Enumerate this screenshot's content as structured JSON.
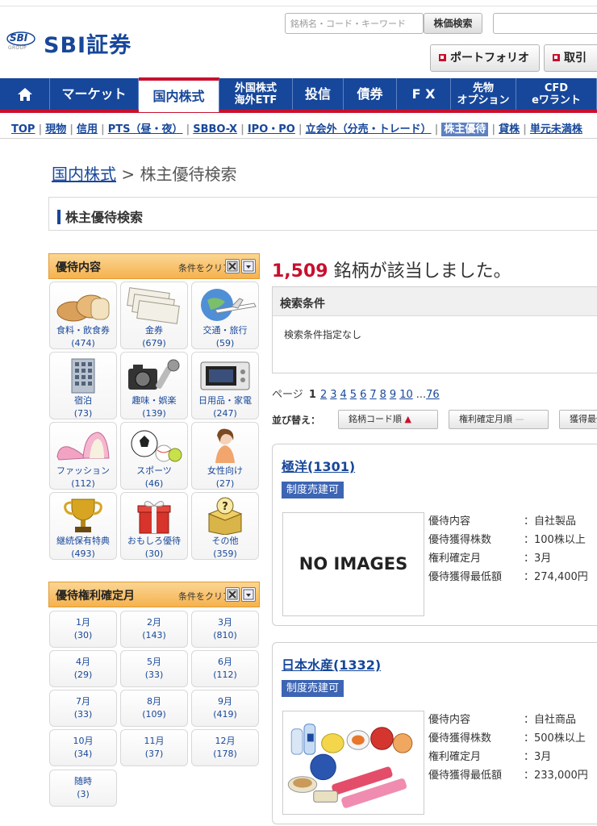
{
  "header": {
    "logo_mark": "SBI",
    "logo_sub": "GROUP",
    "logo_text": "SBI証券",
    "search_placeholder": "銘柄名・コード・キーワード",
    "search_button": "株価検索",
    "portfolio_button": "ポートフォリオ",
    "trade_button": "取引"
  },
  "nav": [
    {
      "label": "マーケット"
    },
    {
      "label": "国内株式",
      "active": true
    },
    {
      "label": "外国株式\n海外ETF"
    },
    {
      "label": "投信"
    },
    {
      "label": "債券"
    },
    {
      "label": "F X"
    },
    {
      "label": "先物\nオプション"
    },
    {
      "label": "CFD\neワラント"
    }
  ],
  "subnav": [
    "TOP",
    "現物",
    "信用",
    "PTS（昼・夜）",
    "SBBO-X",
    "IPO・PO",
    "立会外（分売・トレード）",
    "株主優待",
    "貸株",
    "単元未満株"
  ],
  "subnav_current": "株主優待",
  "breadcrumb": {
    "link": "国内株式",
    "separator": " > ",
    "current": "株主優待検索"
  },
  "page_title": "株主優待検索",
  "benefit_panel": {
    "title": "優待内容",
    "clear_label": "条件をクリア",
    "categories": [
      {
        "label": "食料・飲食券",
        "count": "(474)",
        "icon": "bread-icon"
      },
      {
        "label": "金券",
        "count": "(679)",
        "icon": "voucher-icon"
      },
      {
        "label": "交通・旅行",
        "count": "(59)",
        "icon": "airplane-icon"
      },
      {
        "label": "宿泊",
        "count": "(73)",
        "icon": "hotel-icon"
      },
      {
        "label": "趣味・娯楽",
        "count": "(139)",
        "icon": "camera-icon"
      },
      {
        "label": "日用品・家電",
        "count": "(247)",
        "icon": "microwave-icon"
      },
      {
        "label": "ファッション",
        "count": "(112)",
        "icon": "shoes-icon"
      },
      {
        "label": "スポーツ",
        "count": "(46)",
        "icon": "sports-balls-icon"
      },
      {
        "label": "女性向け",
        "count": "(27)",
        "icon": "woman-icon"
      },
      {
        "label": "継続保有特典",
        "count": "(493)",
        "icon": "trophy-icon"
      },
      {
        "label": "おもしろ優待",
        "count": "(30)",
        "icon": "gift-box-icon"
      },
      {
        "label": "その他",
        "count": "(359)",
        "icon": "question-box-icon"
      }
    ]
  },
  "month_panel": {
    "title": "優待権利確定月",
    "clear_label": "条件をクリア",
    "months": [
      {
        "label": "1月",
        "count": "(30)"
      },
      {
        "label": "2月",
        "count": "(143)"
      },
      {
        "label": "3月",
        "count": "(810)"
      },
      {
        "label": "4月",
        "count": "(29)"
      },
      {
        "label": "5月",
        "count": "(33)"
      },
      {
        "label": "6月",
        "count": "(112)"
      },
      {
        "label": "7月",
        "count": "(33)"
      },
      {
        "label": "8月",
        "count": "(109)"
      },
      {
        "label": "9月",
        "count": "(419)"
      },
      {
        "label": "10月",
        "count": "(34)"
      },
      {
        "label": "11月",
        "count": "(37)"
      },
      {
        "label": "12月",
        "count": "(178)"
      },
      {
        "label": "随時",
        "count": "(3)"
      }
    ]
  },
  "results": {
    "count": "1,509",
    "suffix": " 銘柄が該当しました。",
    "conditions_title": "検索条件",
    "conditions_text": "検索条件指定なし",
    "pager_label": "ページ",
    "current_page": "1",
    "pages": [
      "2",
      "3",
      "4",
      "5",
      "6",
      "7",
      "8",
      "9",
      "10"
    ],
    "ellipsis": "...",
    "last_page": "76",
    "sort_label": "並び替え：",
    "sort_options": [
      "銘柄コード順",
      "権利確定月順",
      "獲得最低額順"
    ]
  },
  "cards": [
    {
      "name": "極洋(1301)",
      "badge": "制度売建可",
      "image_text": "NO IMAGES",
      "props": [
        {
          "k": "優待内容",
          "v": "：自社製品"
        },
        {
          "k": "優待獲得株数",
          "v": "：100株以上"
        },
        {
          "k": "権利確定月",
          "v": "：3月"
        },
        {
          "k": "優待獲得最低額",
          "v": "：274,400円"
        }
      ]
    },
    {
      "name": "日本水産(1332)",
      "badge": "制度売建可",
      "image_text": "",
      "props": [
        {
          "k": "優待内容",
          "v": "：自社商品"
        },
        {
          "k": "優待獲得株数",
          "v": "：500株以上"
        },
        {
          "k": "権利確定月",
          "v": "：3月"
        },
        {
          "k": "優待獲得最低額",
          "v": "：233,000円"
        }
      ]
    }
  ],
  "colors": {
    "brand_blue": "#17479a",
    "accent_red": "#c8102e",
    "panel_orange": "#f5b24e"
  }
}
